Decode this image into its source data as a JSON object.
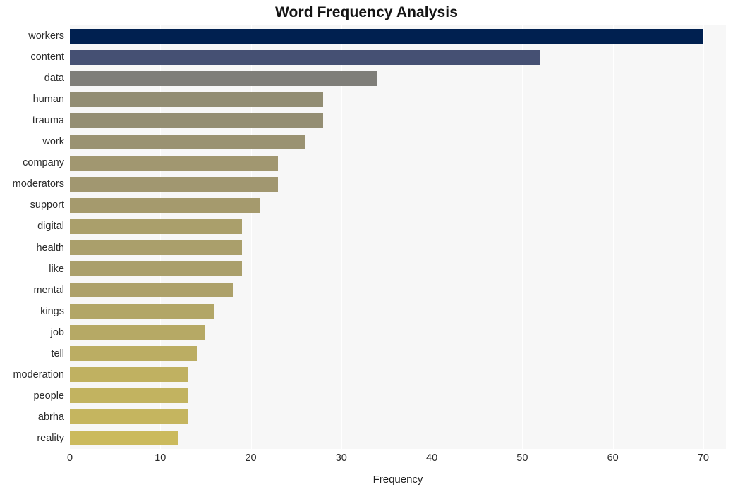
{
  "chart_data": {
    "type": "bar",
    "orientation": "horizontal",
    "title": "Word Frequency Analysis",
    "xlabel": "Frequency",
    "ylabel": "",
    "xlim": [
      0,
      72.5
    ],
    "xticks": [
      0,
      10,
      20,
      30,
      40,
      50,
      60,
      70
    ],
    "grid": "vertical-only",
    "legend": "none",
    "categories": [
      "workers",
      "content",
      "data",
      "human",
      "trauma",
      "work",
      "company",
      "moderators",
      "support",
      "digital",
      "health",
      "like",
      "mental",
      "kings",
      "job",
      "tell",
      "moderation",
      "people",
      "abrha",
      "reality"
    ],
    "values": [
      70,
      52,
      34,
      28,
      28,
      26,
      23,
      23,
      21,
      19,
      19,
      19,
      18,
      16,
      15,
      14,
      13,
      13,
      13,
      12
    ],
    "bar_colors": [
      "#002050",
      "#455073",
      "#7f7e79",
      "#928d73",
      "#948e73",
      "#9a9272",
      "#a19770",
      "#a19770",
      "#a59a6d",
      "#aa9f6b",
      "#aa9f6b",
      "#aa9f6b",
      "#ada16a",
      "#b2a667",
      "#b6a965",
      "#bbad63",
      "#c0b161",
      "#c2b360",
      "#c5b55f",
      "#cbba5d"
    ],
    "plot_background": "#f7f7f7",
    "page_background": "#ffffff",
    "text_color": "#2b2b2b"
  }
}
